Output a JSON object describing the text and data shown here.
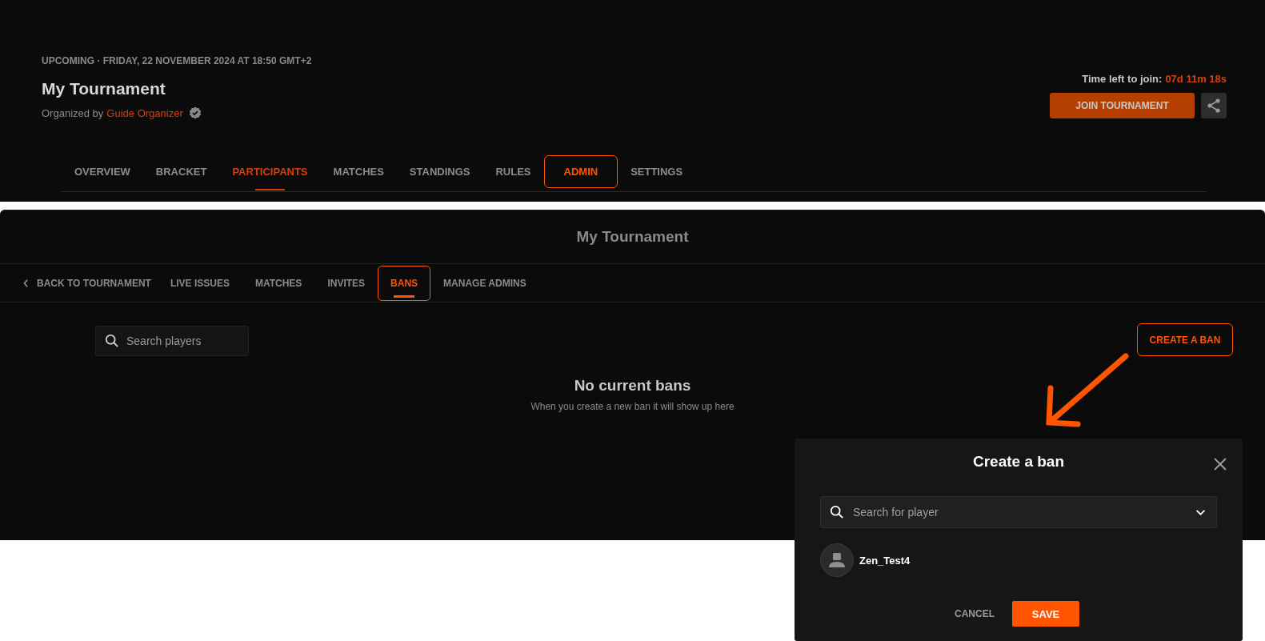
{
  "event": {
    "status_line": "UPCOMING · FRIDAY, 22 NOVEMBER 2024 AT 18:50 GMT+2",
    "title": "My Tournament",
    "organized_by_label": "Organized by",
    "organizer": "Guide Organizer",
    "organizer_verified": true
  },
  "join": {
    "time_left_label": "Time left to join:",
    "time_left": "07d 11m 18s",
    "button": "JOIN TOURNAMENT"
  },
  "tabs": [
    {
      "label": "OVERVIEW",
      "selected": false,
      "highlighted": false
    },
    {
      "label": "BRACKET",
      "selected": false,
      "highlighted": false
    },
    {
      "label": "PARTICIPANTS",
      "selected": true,
      "highlighted": false
    },
    {
      "label": "MATCHES",
      "selected": false,
      "highlighted": false
    },
    {
      "label": "STANDINGS",
      "selected": false,
      "highlighted": false
    },
    {
      "label": "RULES",
      "selected": false,
      "highlighted": false
    },
    {
      "label": "ADMIN",
      "selected": false,
      "highlighted": true
    },
    {
      "label": "SETTINGS",
      "selected": false,
      "highlighted": false
    }
  ],
  "admin_panel": {
    "title": "My Tournament",
    "back_link": "BACK TO TOURNAMENT",
    "tabs": [
      {
        "label": "LIVE ISSUES",
        "selected": false,
        "highlighted": false
      },
      {
        "label": "MATCHES",
        "selected": false,
        "highlighted": false
      },
      {
        "label": "INVITES",
        "selected": false,
        "highlighted": false
      },
      {
        "label": "BANS",
        "selected": true,
        "highlighted": true
      },
      {
        "label": "MANAGE ADMINS",
        "selected": false,
        "highlighted": false
      }
    ],
    "search": {
      "placeholder": "Search players"
    },
    "create_button": {
      "label": "CREATE A BAN",
      "highlighted": true
    },
    "empty_state": {
      "title": "No current bans",
      "message": "When you create a new ban it will show up here"
    }
  },
  "modal": {
    "title": "Create a ban",
    "search": {
      "placeholder": "Search for player"
    },
    "players": [
      {
        "name": "Zen_Test4"
      }
    ],
    "cancel": "CANCEL",
    "save": "SAVE"
  }
}
